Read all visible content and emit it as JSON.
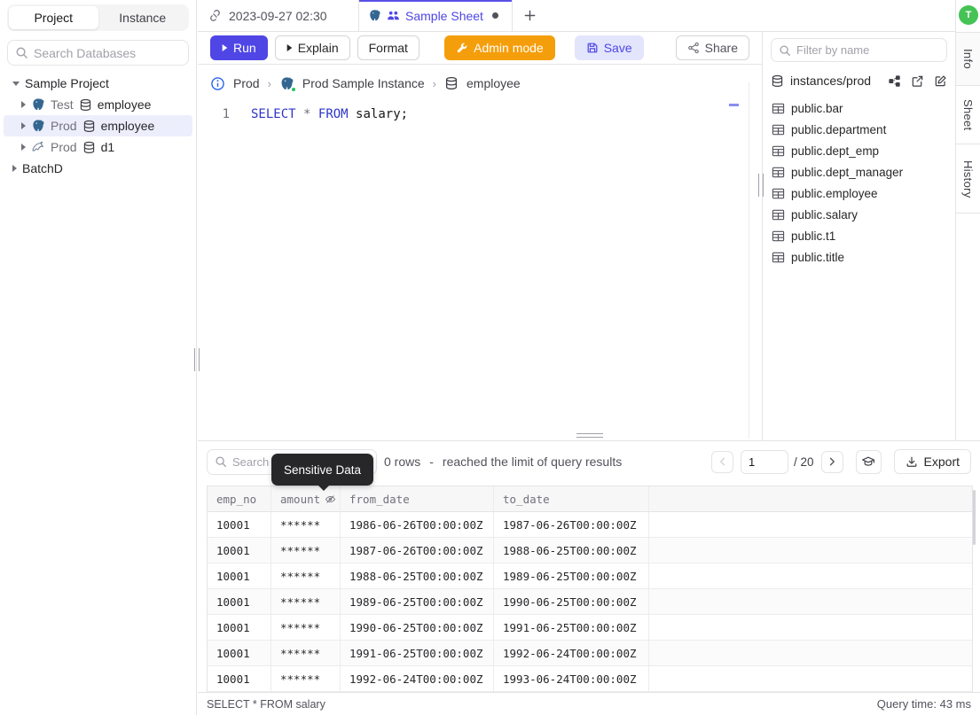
{
  "colors": {
    "accent": "#4f46e5",
    "admin_orange": "#f59e0b",
    "postgres_blue": "#336791",
    "avatar_green": "#45c354"
  },
  "sidebar": {
    "tabs": {
      "project": "Project",
      "instance": "Instance"
    },
    "search_placeholder": "Search Databases",
    "tree": {
      "root": "Sample Project",
      "items": [
        {
          "env": "Test",
          "db": "employee",
          "engine": "postgres"
        },
        {
          "env": "Prod",
          "db": "employee",
          "engine": "postgres"
        },
        {
          "env": "Prod",
          "db": "d1",
          "engine": "mysql"
        }
      ],
      "batch": "BatchD"
    }
  },
  "tab_bar": {
    "history_tab": "2023-09-27 02:30",
    "sheet_tab": "Sample Sheet"
  },
  "toolbar": {
    "run": "Run",
    "explain": "Explain",
    "format": "Format",
    "admin_mode": "Admin mode",
    "save": "Save",
    "share": "Share"
  },
  "breadcrumb": {
    "environment": "Prod",
    "instance": "Prod Sample Instance",
    "database": "employee"
  },
  "editor": {
    "line_number": "1",
    "keyword_select": "SELECT",
    "star": "*",
    "keyword_from": "FROM",
    "identifier": "salary;"
  },
  "schema_panel": {
    "filter_placeholder": "Filter by name",
    "connection": "instances/prod",
    "tables": [
      "public.bar",
      "public.department",
      "public.dept_emp",
      "public.dept_manager",
      "public.employee",
      "public.salary",
      "public.t1",
      "public.title"
    ]
  },
  "right_rail": {
    "avatar_initial": "T",
    "tab_info": "Info",
    "tab_sheet": "Sheet",
    "tab_history": "History"
  },
  "results": {
    "search_placeholder": "Search",
    "tooltip": "Sensitive Data",
    "row_count": "0 rows",
    "separator": "-",
    "limit_message": "reached the limit of query results",
    "page_value": "1",
    "page_total": "/ 20",
    "export_label": "Export",
    "columns": [
      "emp_no",
      "amount",
      "from_date",
      "to_date"
    ],
    "rows": [
      [
        "10001",
        "******",
        "1986-06-26T00:00:00Z",
        "1987-06-26T00:00:00Z"
      ],
      [
        "10001",
        "******",
        "1987-06-26T00:00:00Z",
        "1988-06-25T00:00:00Z"
      ],
      [
        "10001",
        "******",
        "1988-06-25T00:00:00Z",
        "1989-06-25T00:00:00Z"
      ],
      [
        "10001",
        "******",
        "1989-06-25T00:00:00Z",
        "1990-06-25T00:00:00Z"
      ],
      [
        "10001",
        "******",
        "1990-06-25T00:00:00Z",
        "1991-06-25T00:00:00Z"
      ],
      [
        "10001",
        "******",
        "1991-06-25T00:00:00Z",
        "1992-06-24T00:00:00Z"
      ],
      [
        "10001",
        "******",
        "1992-06-24T00:00:00Z",
        "1993-06-24T00:00:00Z"
      ]
    ],
    "statement": "SELECT * FROM salary",
    "query_time": "Query time: 43 ms"
  }
}
